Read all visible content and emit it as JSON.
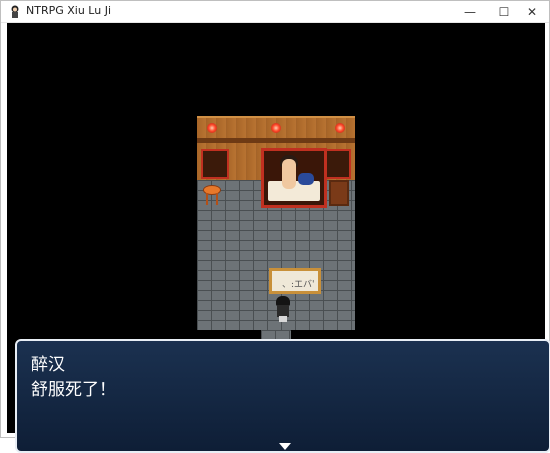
{
  "window": {
    "title": "NTRPG Xiu Lu Ji",
    "icons": {
      "app": "game-character-icon",
      "minimize": "minimize-icon",
      "maximize": "maximize-icon",
      "close": "close-icon"
    },
    "min_glyph": "—",
    "max_glyph": "☐",
    "close_glyph": "✕"
  },
  "scene": {
    "painting_text": "、:エバ'"
  },
  "dialog": {
    "speaker": "醉汉",
    "message": "舒服死了！",
    "continue_icon": "triangle-down-icon"
  },
  "colors": {
    "dialog_bg": "#1b3150",
    "dialog_border": "#e8eef5",
    "game_bg": "#000000"
  }
}
